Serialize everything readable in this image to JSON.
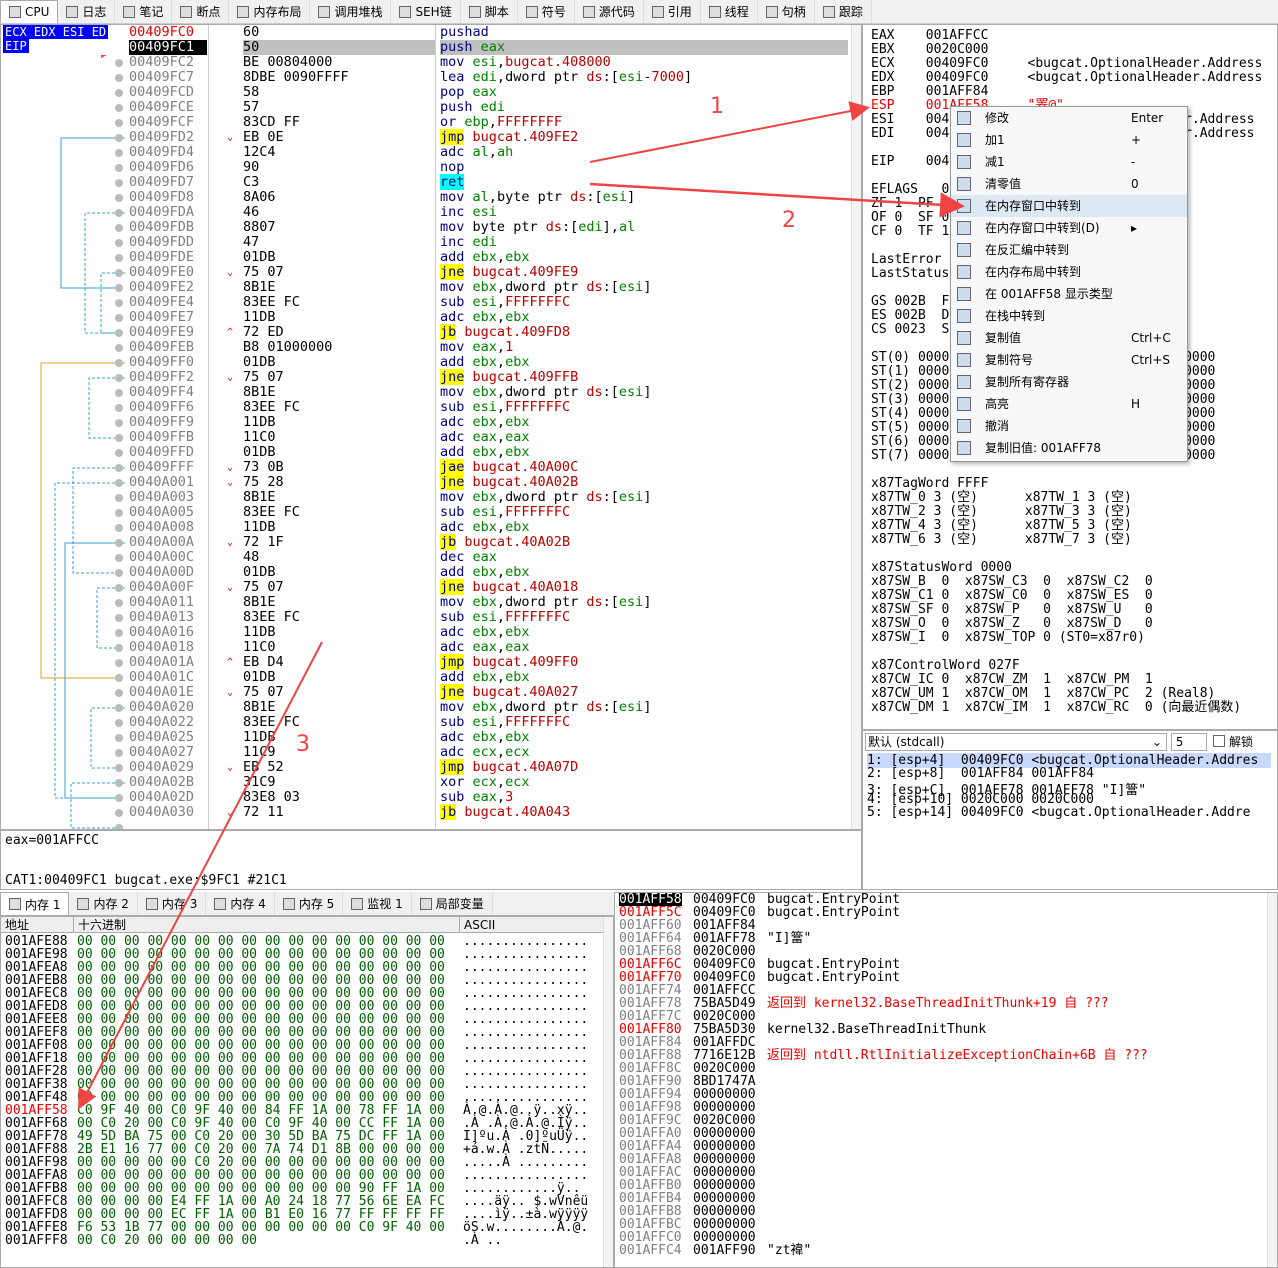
{
  "tabs": [
    {
      "label": "CPU",
      "icon": "cpu-icon"
    },
    {
      "label": "日志",
      "icon": "log-icon"
    },
    {
      "label": "笔记",
      "icon": "notes-icon"
    },
    {
      "label": "断点",
      "icon": "breakpoint-icon"
    },
    {
      "label": "内存布局",
      "icon": "memory-map-icon"
    },
    {
      "label": "调用堆栈",
      "icon": "callstack-icon"
    },
    {
      "label": "SEH链",
      "icon": "seh-icon"
    },
    {
      "label": "脚本",
      "icon": "script-icon"
    },
    {
      "label": "符号",
      "icon": "symbols-icon"
    },
    {
      "label": "源代码",
      "icon": "source-icon"
    },
    {
      "label": "引用",
      "icon": "references-icon"
    },
    {
      "label": "线程",
      "icon": "threads-icon"
    },
    {
      "label": "句柄",
      "icon": "handles-icon"
    },
    {
      "label": "跟踪",
      "icon": "trace-icon"
    }
  ],
  "reg_tags": {
    "top": "ECX EDX ESI ED",
    "eip": "EIP"
  },
  "disasm": [
    {
      "addr": "00409FC0",
      "bytes": "60",
      "ins": "pushad",
      "style": "red"
    },
    {
      "addr": "00409FC1",
      "bytes": "50",
      "ins": "push eax",
      "style": "cur"
    },
    {
      "addr": "00409FC2",
      "bytes": "BE 00804000",
      "ins": "mov esi,bugcat.408000"
    },
    {
      "addr": "00409FC7",
      "bytes": "8DBE 0090FFFF",
      "ins": "lea edi,dword ptr ds:[esi-7000]"
    },
    {
      "addr": "00409FCD",
      "bytes": "58",
      "ins": "pop eax"
    },
    {
      "addr": "00409FCE",
      "bytes": "57",
      "ins": "push edi"
    },
    {
      "addr": "00409FCF",
      "bytes": "83CD FF",
      "ins": "or ebp,FFFFFFFF"
    },
    {
      "addr": "00409FD2",
      "bytes": "EB 0E",
      "ins": "jmp bugcat.409FE2",
      "hl": "y",
      "mark": "v"
    },
    {
      "addr": "00409FD4",
      "bytes": "12C4",
      "ins": "adc al,ah"
    },
    {
      "addr": "00409FD6",
      "bytes": "90",
      "ins": "nop"
    },
    {
      "addr": "00409FD7",
      "bytes": "C3",
      "ins": "ret",
      "hl": "c"
    },
    {
      "addr": "00409FD8",
      "bytes": "8A06",
      "ins": "mov al,byte ptr ds:[esi]"
    },
    {
      "addr": "00409FDA",
      "bytes": "46",
      "ins": "inc esi"
    },
    {
      "addr": "00409FDB",
      "bytes": "8807",
      "ins": "mov byte ptr ds:[edi],al"
    },
    {
      "addr": "00409FDD",
      "bytes": "47",
      "ins": "inc edi"
    },
    {
      "addr": "00409FDE",
      "bytes": "01DB",
      "ins": "add ebx,ebx"
    },
    {
      "addr": "00409FE0",
      "bytes": "75 07",
      "ins": "jne bugcat.409FE9",
      "hl": "y",
      "mark": "v"
    },
    {
      "addr": "00409FE2",
      "bytes": "8B1E",
      "ins": "mov ebx,dword ptr ds:[esi]"
    },
    {
      "addr": "00409FE4",
      "bytes": "83EE FC",
      "ins": "sub esi,FFFFFFFC"
    },
    {
      "addr": "00409FE7",
      "bytes": "11DB",
      "ins": "adc ebx,ebx"
    },
    {
      "addr": "00409FE9",
      "bytes": "72 ED",
      "ins": "jb bugcat.409FD8",
      "hl": "y",
      "mark": "^"
    },
    {
      "addr": "00409FEB",
      "bytes": "B8 01000000",
      "ins": "mov eax,1"
    },
    {
      "addr": "00409FF0",
      "bytes": "01DB",
      "ins": "add ebx,ebx"
    },
    {
      "addr": "00409FF2",
      "bytes": "75 07",
      "ins": "jne bugcat.409FFB",
      "hl": "y",
      "mark": "v"
    },
    {
      "addr": "00409FF4",
      "bytes": "8B1E",
      "ins": "mov ebx,dword ptr ds:[esi]"
    },
    {
      "addr": "00409FF6",
      "bytes": "83EE FC",
      "ins": "sub esi,FFFFFFFC"
    },
    {
      "addr": "00409FF9",
      "bytes": "11DB",
      "ins": "adc ebx,ebx"
    },
    {
      "addr": "00409FFB",
      "bytes": "11C0",
      "ins": "adc eax,eax"
    },
    {
      "addr": "00409FFD",
      "bytes": "01DB",
      "ins": "add ebx,ebx"
    },
    {
      "addr": "00409FFF",
      "bytes": "73 0B",
      "ins": "jae bugcat.40A00C",
      "hl": "y",
      "mark": "v"
    },
    {
      "addr": "0040A001",
      "bytes": "75 28",
      "ins": "jne bugcat.40A02B",
      "hl": "y",
      "mark": "v"
    },
    {
      "addr": "0040A003",
      "bytes": "8B1E",
      "ins": "mov ebx,dword ptr ds:[esi]"
    },
    {
      "addr": "0040A005",
      "bytes": "83EE FC",
      "ins": "sub esi,FFFFFFFC"
    },
    {
      "addr": "0040A008",
      "bytes": "11DB",
      "ins": "adc ebx,ebx"
    },
    {
      "addr": "0040A00A",
      "bytes": "72 1F",
      "ins": "jb bugcat.40A02B",
      "hl": "y",
      "mark": "v"
    },
    {
      "addr": "0040A00C",
      "bytes": "48",
      "ins": "dec eax"
    },
    {
      "addr": "0040A00D",
      "bytes": "01DB",
      "ins": "add ebx,ebx"
    },
    {
      "addr": "0040A00F",
      "bytes": "75 07",
      "ins": "jne bugcat.40A018",
      "hl": "y",
      "mark": "v"
    },
    {
      "addr": "0040A011",
      "bytes": "8B1E",
      "ins": "mov ebx,dword ptr ds:[esi]"
    },
    {
      "addr": "0040A013",
      "bytes": "83EE FC",
      "ins": "sub esi,FFFFFFFC"
    },
    {
      "addr": "0040A016",
      "bytes": "11DB",
      "ins": "adc ebx,ebx"
    },
    {
      "addr": "0040A018",
      "bytes": "11C0",
      "ins": "adc eax,eax"
    },
    {
      "addr": "0040A01A",
      "bytes": "EB D4",
      "ins": "jmp bugcat.409FF0",
      "hl": "y",
      "mark": "^"
    },
    {
      "addr": "0040A01C",
      "bytes": "01DB",
      "ins": "add ebx,ebx"
    },
    {
      "addr": "0040A01E",
      "bytes": "75 07",
      "ins": "jne bugcat.40A027",
      "hl": "y",
      "mark": "v"
    },
    {
      "addr": "0040A020",
      "bytes": "8B1E",
      "ins": "mov ebx,dword ptr ds:[esi]"
    },
    {
      "addr": "0040A022",
      "bytes": "83EE FC",
      "ins": "sub esi,FFFFFFFC"
    },
    {
      "addr": "0040A025",
      "bytes": "11DB",
      "ins": "adc ebx,ebx"
    },
    {
      "addr": "0040A027",
      "bytes": "11C9",
      "ins": "adc ecx,ecx"
    },
    {
      "addr": "0040A029",
      "bytes": "EB 52",
      "ins": "jmp bugcat.40A07D",
      "hl": "y",
      "mark": "v"
    },
    {
      "addr": "0040A02B",
      "bytes": "31C9",
      "ins": "xor ecx,ecx"
    },
    {
      "addr": "0040A02D",
      "bytes": "83E8 03",
      "ins": "sub eax,3"
    },
    {
      "addr": "0040A030",
      "bytes": "72 11",
      "ins": "jb bugcat.40A043",
      "hl": "y",
      "mark": "v"
    }
  ],
  "registers": [
    {
      "t": "EAX    001AFFCC"
    },
    {
      "t": "EBX    0020C000"
    },
    {
      "t": "ECX    00409FC0     <bugcat.OptionalHeader.Address"
    },
    {
      "t": "EDX    00409FC0     <bugcat.OptionalHeader.Address"
    },
    {
      "t": "EBP    001AFF84"
    },
    {
      "t": "ESP    001AFF58     \"罴@\"",
      "red": true
    },
    {
      "t": "ESI    0040                            er.Address"
    },
    {
      "t": "EDI    0040                            er.Address"
    },
    {
      "t": ""
    },
    {
      "t": "EIP    0040"
    },
    {
      "t": ""
    },
    {
      "t": "EFLAGS   0"
    },
    {
      "t": "ZF 1  PF"
    },
    {
      "t": "OF 0  SF 0"
    },
    {
      "t": "CF 0  TF 1"
    },
    {
      "t": ""
    },
    {
      "t": "LastError"
    },
    {
      "t": "LastStatus"
    },
    {
      "t": ""
    },
    {
      "t": "GS 002B  F"
    },
    {
      "t": "ES 002B  D"
    },
    {
      "t": "CS 0023  S"
    },
    {
      "t": ""
    },
    {
      "t": "ST(0) 0000                        0000000000"
    },
    {
      "t": "ST(1) 0000                        0000000000"
    },
    {
      "t": "ST(2) 0000                        0000000000"
    },
    {
      "t": "ST(3) 0000                        0000000000"
    },
    {
      "t": "ST(4) 0000                        0000000000"
    },
    {
      "t": "ST(5) 0000                        0000000000"
    },
    {
      "t": "ST(6) 0000                        0000000000"
    },
    {
      "t": "ST(7) 0000                        0000000000"
    },
    {
      "t": ""
    },
    {
      "t": "x87TagWord FFFF"
    },
    {
      "t": "x87TW_0 3 (空)      x87TW_1 3 (空)"
    },
    {
      "t": "x87TW_2 3 (空)      x87TW_3 3 (空)"
    },
    {
      "t": "x87TW_4 3 (空)      x87TW_5 3 (空)"
    },
    {
      "t": "x87TW_6 3 (空)      x87TW_7 3 (空)"
    },
    {
      "t": ""
    },
    {
      "t": "x87StatusWord 0000"
    },
    {
      "t": "x87SW_B  0  x87SW_C3  0  x87SW_C2  0"
    },
    {
      "t": "x87SW_C1 0  x87SW_C0  0  x87SW_ES  0"
    },
    {
      "t": "x87SW_SF 0  x87SW_P   0  x87SW_U   0"
    },
    {
      "t": "x87SW_O  0  x87SW_Z   0  x87SW_D   0"
    },
    {
      "t": "x87SW_I  0  x87SW_TOP 0 (ST0=x87r0)"
    },
    {
      "t": ""
    },
    {
      "t": "x87ControlWord 027F"
    },
    {
      "t": "x87CW_IC 0  x87CW_ZM  1  x87CW_PM  1"
    },
    {
      "t": "x87CW_UM 1  x87CW_OM  1  x87CW_PC  2 (Real8)"
    },
    {
      "t": "x87CW_DM 1  x87CW_IM  1  x87CW_RC  0 (向最近偶数)"
    }
  ],
  "callconv": {
    "select": "默认 (stdcall)",
    "count": "5",
    "unlock": "解锁"
  },
  "callstack": [
    "1: [esp+4]  00409FC0 <bugcat.OptionalHeader.Addres",
    "2: [esp+8]  001AFF84 001AFF84",
    "3: [esp+C]  001AFF78 001AFF78 \"I]簹\"",
    "4: [esp+10] 0020C000 0020C000",
    "5: [esp+14] 00409FC0 <bugcat.OptionalHeader.Addre"
  ],
  "info": {
    "line1": "eax=001AFFCC",
    "line2": "CAT1:00409FC1 bugcat.exe:$9FC1 #21C1"
  },
  "memtabs": [
    {
      "label": "内存 1",
      "icon": "memory-icon"
    },
    {
      "label": "内存 2",
      "icon": "memory-icon"
    },
    {
      "label": "内存 3",
      "icon": "memory-icon"
    },
    {
      "label": "内存 4",
      "icon": "memory-icon"
    },
    {
      "label": "内存 5",
      "icon": "memory-icon"
    },
    {
      "label": "监视 1",
      "icon": "watch-icon"
    },
    {
      "label": "局部变量",
      "icon": "locals-icon"
    }
  ],
  "dump_head": {
    "addr": "地址",
    "hex": "十六进制",
    "ascii": "ASCII"
  },
  "dump": [
    {
      "a": "001AFE88",
      "h": "00 00 00 00 00 00 00 00 00 00 00 00 00 00 00 00",
      "s": "................"
    },
    {
      "a": "001AFE98",
      "h": "00 00 00 00 00 00 00 00 00 00 00 00 00 00 00 00",
      "s": "................"
    },
    {
      "a": "001AFEA8",
      "h": "00 00 00 00 00 00 00 00 00 00 00 00 00 00 00 00",
      "s": "................"
    },
    {
      "a": "001AFEB8",
      "h": "00 00 00 00 00 00 00 00 00 00 00 00 00 00 00 00",
      "s": "................"
    },
    {
      "a": "001AFEC8",
      "h": "00 00 00 00 00 00 00 00 00 00 00 00 00 00 00 00",
      "s": "................"
    },
    {
      "a": "001AFED8",
      "h": "00 00 00 00 00 00 00 00 00 00 00 00 00 00 00 00",
      "s": "................"
    },
    {
      "a": "001AFEE8",
      "h": "00 00 00 00 00 00 00 00 00 00 00 00 00 00 00 00",
      "s": "................"
    },
    {
      "a": "001AFEF8",
      "h": "00 00 00 00 00 00 00 00 00 00 00 00 00 00 00 00",
      "s": "................"
    },
    {
      "a": "001AFF08",
      "h": "00 00 00 00 00 00 00 00 00 00 00 00 00 00 00 00",
      "s": "................"
    },
    {
      "a": "001AFF18",
      "h": "00 00 00 00 00 00 00 00 00 00 00 00 00 00 00 00",
      "s": "................"
    },
    {
      "a": "001AFF28",
      "h": "00 00 00 00 00 00 00 00 00 00 00 00 00 00 00 00",
      "s": "................"
    },
    {
      "a": "001AFF38",
      "h": "00 00 00 00 00 00 00 00 00 00 00 00 00 00 00 00",
      "s": "................"
    },
    {
      "a": "001AFF48",
      "h": "00 00 00 00 00 00 00 00 00 00 00 00 00 00 00 00",
      "s": "................"
    },
    {
      "a": "001AFF58",
      "h": "C0 9F 40 00 C0 9F 40 00 84 FF 1A 00 78 FF 1A 00",
      "s": "À.@.À.@..ÿ..xÿ..",
      "red": true
    },
    {
      "a": "001AFF68",
      "h": "00 C0 20 00 C0 9F 40 00 C0 9F 40 00 CC FF 1A 00",
      "s": ".À .À.@.À.@.Ìÿ.."
    },
    {
      "a": "001AFF78",
      "h": "49 5D BA 75 00 C0 20 00 30 5D BA 75 DC FF 1A 00",
      "s": "I]ºu.À .0]ºuÜÿ.."
    },
    {
      "a": "001AFF88",
      "h": "2B E1 16 77 00 C0 20 00 7A 74 D1 8B 00 00 00 00",
      "s": "+á.w.À .ztÑ....."
    },
    {
      "a": "001AFF98",
      "h": "00 00 00 00 00 C0 20 00 00 00 00 00 00 00 00 00",
      "s": ".....À ........."
    },
    {
      "a": "001AFFA8",
      "h": "00 00 00 00 00 00 00 00 00 00 00 00 00 00 00 00",
      "s": "................"
    },
    {
      "a": "001AFFB8",
      "h": "00 00 00 00 00 00 00 00 00 00 00 00 90 FF 1A 00",
      "s": "............ÿ.."
    },
    {
      "a": "001AFFC8",
      "h": "00 00 00 00 E4 FF 1A 00 A0 24 18 77 56 6E EA FC",
      "s": "....äÿ.. $.wVnêü"
    },
    {
      "a": "001AFFD8",
      "h": "00 00 00 00 EC FF 1A 00 B1 E0 16 77 FF FF FF FF",
      "s": "....ìÿ..±à.wÿÿÿÿ"
    },
    {
      "a": "001AFFE8",
      "h": "F6 53 1B 77 00 00 00 00 00 00 00 00 C0 9F 40 00",
      "s": "öS.w........À.@."
    },
    {
      "a": "001AFFF8",
      "h": "00 C0 20 00 00 00 00 00",
      "s": ".À .."
    }
  ],
  "stack": [
    {
      "a": "001AFF58",
      "v": "00409FC0",
      "c": "bugcat.EntryPoint",
      "cur": true
    },
    {
      "a": "001AFF5C",
      "v": "00409FC0",
      "c": "bugcat.EntryPoint",
      "red": true
    },
    {
      "a": "001AFF60",
      "v": "001AFF84",
      "c": ""
    },
    {
      "a": "001AFF64",
      "v": "001AFF78",
      "c": "\"I]簹\""
    },
    {
      "a": "001AFF68",
      "v": "0020C000",
      "c": ""
    },
    {
      "a": "001AFF6C",
      "v": "00409FC0",
      "c": "bugcat.EntryPoint",
      "red": true
    },
    {
      "a": "001AFF70",
      "v": "00409FC0",
      "c": "bugcat.EntryPoint",
      "red": true
    },
    {
      "a": "001AFF74",
      "v": "001AFFCC",
      "c": ""
    },
    {
      "a": "001AFF78",
      "v": "75BA5D49",
      "c": "返回到 kernel32.BaseThreadInitThunk+19 自 ???",
      "cred": true
    },
    {
      "a": "001AFF7C",
      "v": "0020C000",
      "c": ""
    },
    {
      "a": "001AFF80",
      "v": "75BA5D30",
      "c": "kernel32.BaseThreadInitThunk",
      "red": true
    },
    {
      "a": "001AFF84",
      "v": "001AFFDC",
      "c": ""
    },
    {
      "a": "001AFF88",
      "v": "7716E12B",
      "c": "返回到 ntdll.RtlInitializeExceptionChain+6B 自 ???",
      "cred": true
    },
    {
      "a": "001AFF8C",
      "v": "0020C000",
      "c": ""
    },
    {
      "a": "001AFF90",
      "v": "8BD1747A",
      "c": ""
    },
    {
      "a": "001AFF94",
      "v": "00000000",
      "c": ""
    },
    {
      "a": "001AFF98",
      "v": "00000000",
      "c": ""
    },
    {
      "a": "001AFF9C",
      "v": "0020C000",
      "c": ""
    },
    {
      "a": "001AFFA0",
      "v": "00000000",
      "c": ""
    },
    {
      "a": "001AFFA4",
      "v": "00000000",
      "c": ""
    },
    {
      "a": "001AFFA8",
      "v": "00000000",
      "c": ""
    },
    {
      "a": "001AFFAC",
      "v": "00000000",
      "c": ""
    },
    {
      "a": "001AFFB0",
      "v": "00000000",
      "c": ""
    },
    {
      "a": "001AFFB4",
      "v": "00000000",
      "c": ""
    },
    {
      "a": "001AFFB8",
      "v": "00000000",
      "c": ""
    },
    {
      "a": "001AFFBC",
      "v": "00000000",
      "c": ""
    },
    {
      "a": "001AFFC0",
      "v": "00000000",
      "c": ""
    },
    {
      "a": "001AFFC4",
      "v": "001AFF90",
      "c": "\"zt褘\""
    }
  ],
  "menu": [
    {
      "label": "修改",
      "sc": "Enter",
      "icon": "edit-icon"
    },
    {
      "label": "加1",
      "sc": "+",
      "icon": "increment-icon"
    },
    {
      "label": "减1",
      "sc": "-",
      "icon": "decrement-icon"
    },
    {
      "label": "清零值",
      "sc": "0",
      "icon": "zero-icon"
    },
    {
      "label": "在内存窗口中转到",
      "sc": "",
      "icon": "memory-goto-icon",
      "hover": true
    },
    {
      "label": "在内存窗口中转到(D)",
      "sc": "▸",
      "icon": "memory-goto-sub-icon"
    },
    {
      "label": "在反汇编中转到",
      "sc": "",
      "icon": "disasm-goto-icon"
    },
    {
      "label": "在内存布局中转到",
      "sc": "",
      "icon": "memmap-goto-icon"
    },
    {
      "label": "在 001AFF58 显示类型",
      "sc": "",
      "icon": "type-icon"
    },
    {
      "label": "在栈中转到",
      "sc": "",
      "icon": "stack-goto-icon"
    },
    {
      "label": "复制值",
      "sc": "Ctrl+C",
      "icon": "copy-icon"
    },
    {
      "label": "复制符号",
      "sc": "Ctrl+S",
      "icon": "copy-symbol-icon"
    },
    {
      "label": "复制所有寄存器",
      "sc": "",
      "icon": "copy-all-icon"
    },
    {
      "label": "高亮",
      "sc": "H",
      "icon": "highlight-icon"
    },
    {
      "label": "撤消",
      "sc": "",
      "icon": "undo-icon"
    },
    {
      "label": "复制旧值: 001AFF78",
      "sc": "",
      "icon": "copy-old-icon"
    }
  ],
  "annotations": [
    "1",
    "2",
    "3"
  ]
}
